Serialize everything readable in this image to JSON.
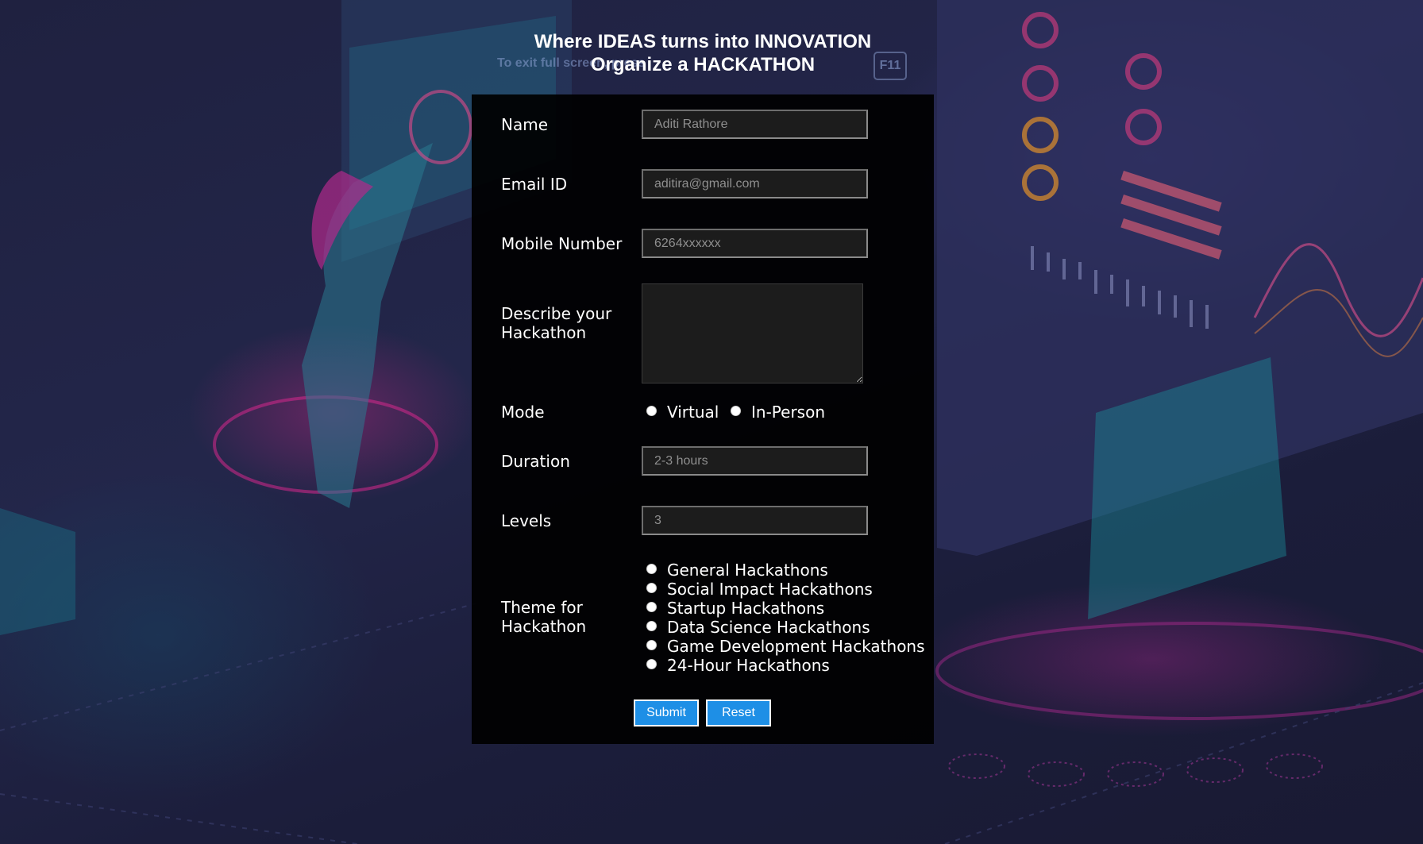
{
  "header": {
    "title_line1": "Where IDEAS turns into INNOVATION",
    "title_line2": "Organize a HACKATHON"
  },
  "fullscreen_hint": {
    "text": "To exit full screen, press",
    "key": "F11"
  },
  "form": {
    "name": {
      "label": "Name",
      "placeholder": "Aditi Rathore"
    },
    "email": {
      "label": "Email ID",
      "placeholder": "aditira@gmail.com"
    },
    "mobile": {
      "label": "Mobile Number",
      "placeholder": "6264xxxxxx"
    },
    "description": {
      "label_line1": "Describe your",
      "label_line2": "Hackathon",
      "value": ""
    },
    "mode": {
      "label": "Mode",
      "options": [
        "Virtual",
        "In-Person"
      ],
      "selected": null
    },
    "duration": {
      "label": "Duration",
      "placeholder": "2-3 hours"
    },
    "levels": {
      "label": "Levels",
      "placeholder": "3"
    },
    "theme": {
      "label_line1": "Theme for",
      "label_line2": "Hackathon",
      "options": [
        "General Hackathons",
        "Social Impact Hackathons",
        "Startup Hackathons",
        "Data Science Hackathons",
        "Game Development Hackathons",
        "24-Hour Hackathons"
      ],
      "selected": null
    },
    "submit_label": "Submit",
    "reset_label": "Reset"
  },
  "colors": {
    "button": "#1e8fe6",
    "panel": "#000000",
    "accent_pink": "#d6288c",
    "accent_teal": "#1fb3c4"
  }
}
